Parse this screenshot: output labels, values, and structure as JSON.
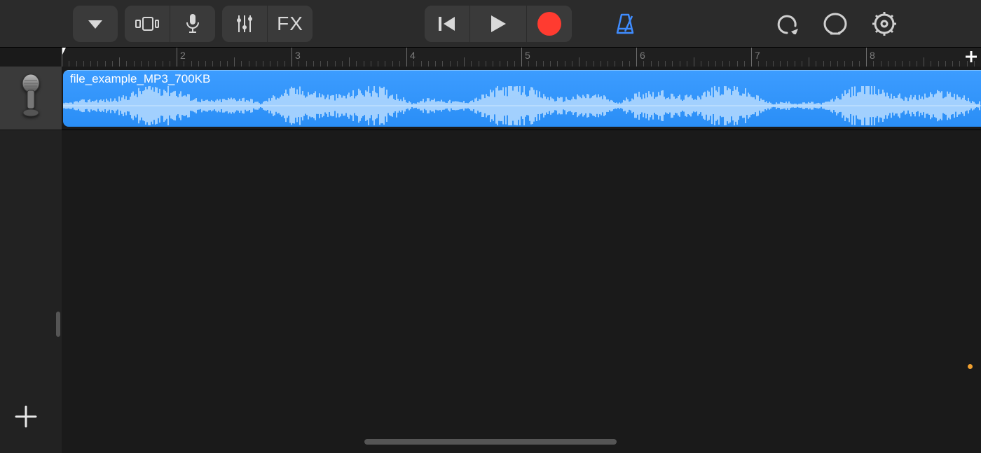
{
  "toolbar": {
    "view_dropdown": "▼",
    "fx_label": "FX",
    "metronome_color": "#3f8cff",
    "record_color": "#ff3b30"
  },
  "ruler": {
    "start": 1,
    "visible_end": 9,
    "labels": [
      2,
      3,
      4,
      5,
      6,
      7,
      8
    ],
    "subdivisions": 16
  },
  "tracks": [
    {
      "type": "audio",
      "icon": "microphone",
      "clip_name": "file_example_MP3_700KB",
      "clip_color": "#2a8ef6"
    }
  ],
  "icons": {
    "settings": "gear",
    "undo": "undo-arrow",
    "loop": "loop",
    "play": "play",
    "rewind": "skip-start",
    "record": "record",
    "mixer": "sliders",
    "input": "microphone",
    "track_view": "track-view",
    "add_track": "plus",
    "add_section": "plus"
  }
}
